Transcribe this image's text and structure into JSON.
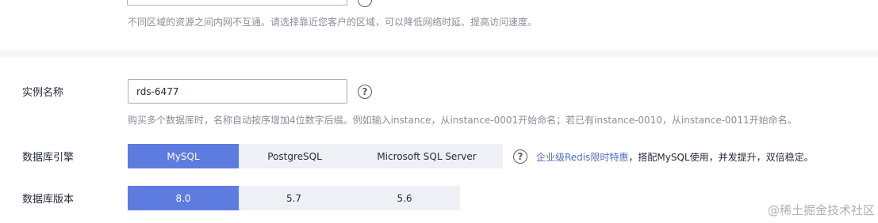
{
  "region": {
    "hint": "不同区域的资源之间内网不互通。请选择靠近您客户的区域，可以降低网络时延、提高访问速度。"
  },
  "instance_name": {
    "label": "实例名称",
    "value": "rds-6477",
    "hint": "购买多个数据库时，名称自动按序增加4位数字后缀。例如输入instance，从instance-0001开始命名；若已有instance-0010，从instance-0011开始命名。"
  },
  "db_engine": {
    "label": "数据库引擎",
    "options": [
      "MySQL",
      "PostgreSQL",
      "Microsoft SQL Server"
    ],
    "selected": "MySQL",
    "promo_link": "企业级Redis限时特惠",
    "promo_text": "，搭配MySQL使用，并发提升，双倍稳定。"
  },
  "db_version": {
    "label": "数据库版本",
    "options": [
      "8.0",
      "5.7",
      "5.6"
    ],
    "selected": "8.0"
  },
  "help_icon_glyph": "?",
  "watermark": "@稀土掘金技术社区",
  "colors": {
    "accent": "#5e7ce0",
    "link": "#526ecc",
    "segment_bg": "#eef0f5",
    "hint_text": "#8a8e99"
  }
}
